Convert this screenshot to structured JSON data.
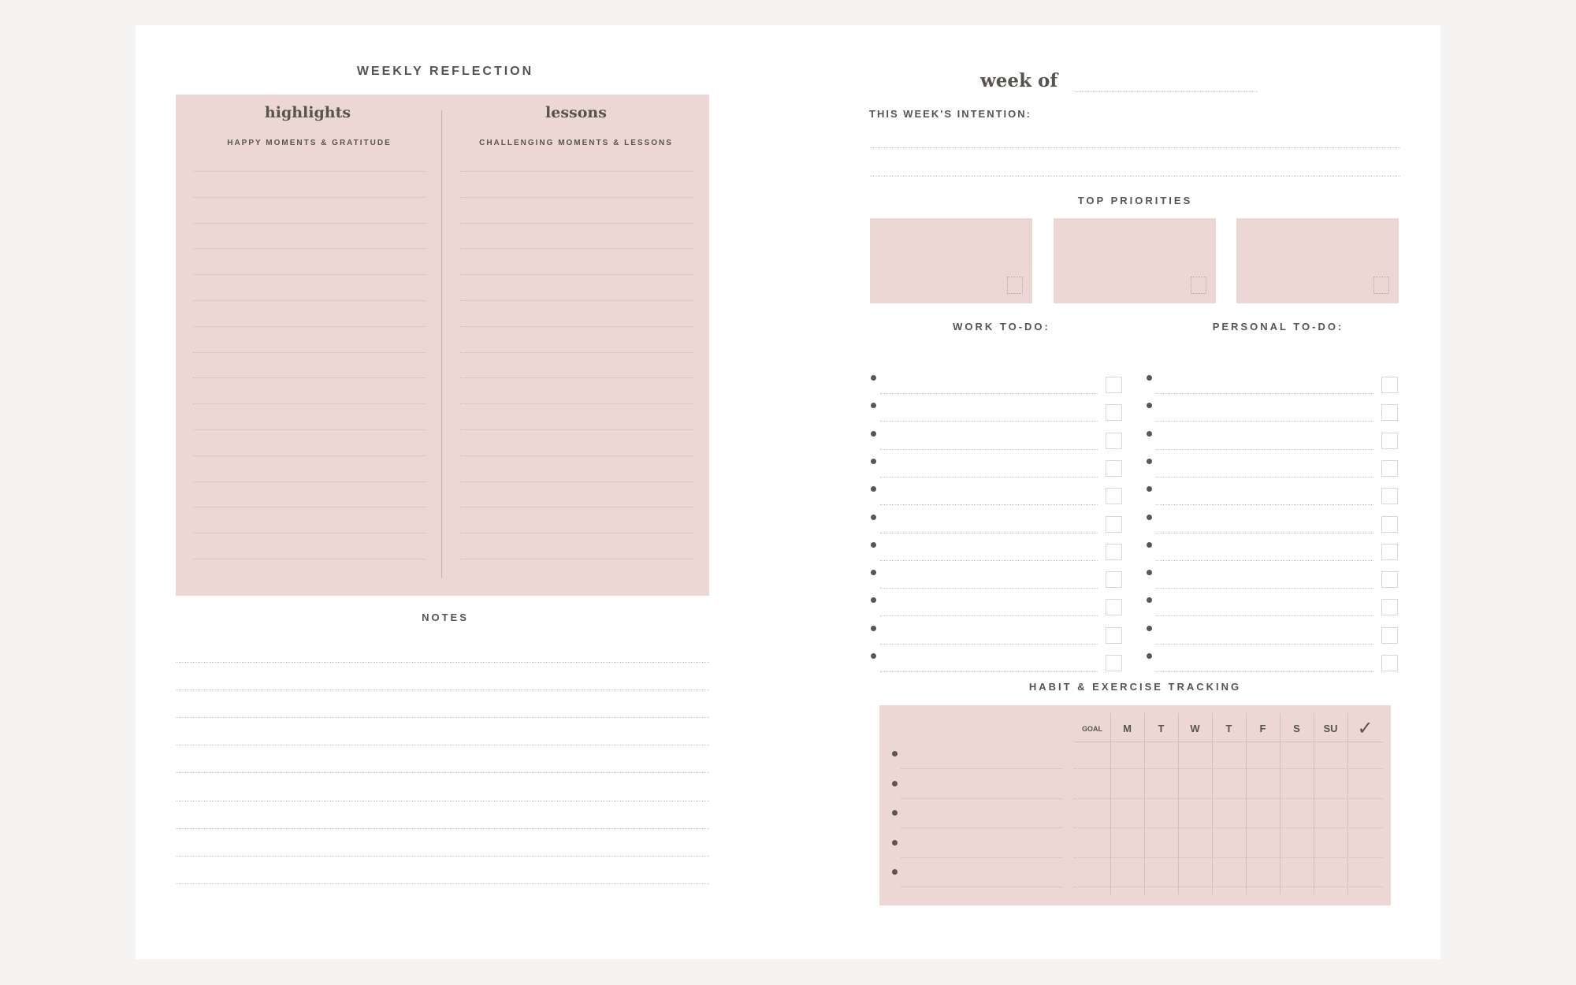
{
  "left": {
    "reflection_title": "WEEKLY REFLECTION",
    "highlights": {
      "title": "highlights",
      "subtitle": "HAPPY MOMENTS & GRATITUDE"
    },
    "lessons": {
      "title": "lessons",
      "subtitle": "CHALLENGING MOMENTS & LESSONS"
    },
    "notes_title": "NOTES"
  },
  "right": {
    "week_of": "week of",
    "intention_label": "THIS WEEK'S INTENTION:",
    "priorities_title": "TOP PRIORITIES",
    "work_todo": "WORK TO-DO:",
    "personal_todo": "PERSONAL TO-DO:",
    "habit_title": "HABIT & EXERCISE TRACKING",
    "habit_headers": [
      "GOAL",
      "M",
      "T",
      "W",
      "T",
      "F",
      "S",
      "Su",
      "✓"
    ]
  },
  "colors": {
    "accent_pink": "#edd7d5",
    "text": "#57534f",
    "background": "#f5f4f2"
  }
}
